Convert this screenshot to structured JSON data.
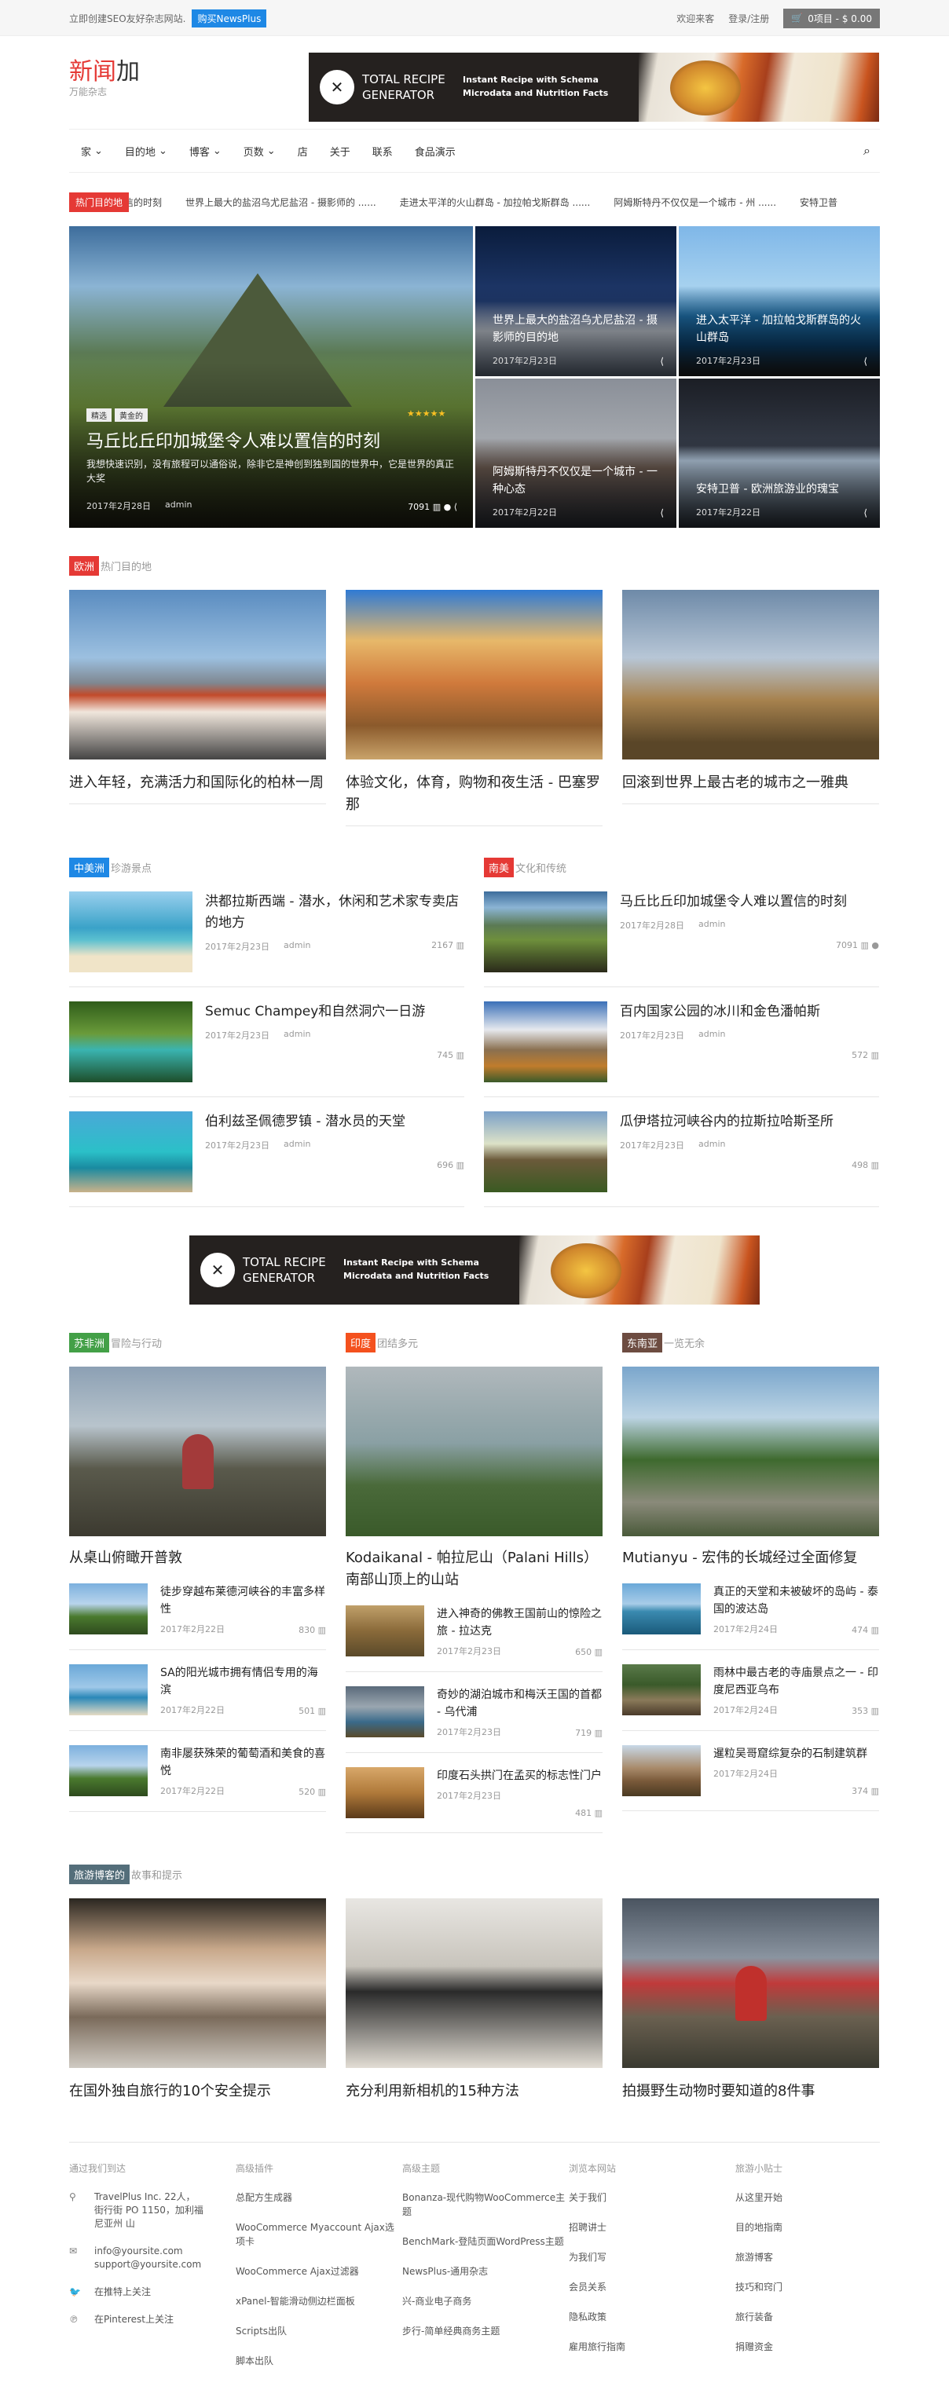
{
  "topbar": {
    "note": "立即创建SEO友好杂志网站.",
    "buy": "购买NewsPlus",
    "links": [
      "欢迎来客",
      "登录/注册"
    ],
    "cart": "0项目 - $ 0.00"
  },
  "header": {
    "logo_a": "新闻",
    "logo_b": "加",
    "tagline": "万能杂志"
  },
  "banner": {
    "title": "TOTAL RECIPE GENERATOR",
    "text": "Instant Recipe with Schema Microdata and Nutrition Facts"
  },
  "nav": {
    "items": [
      "家",
      "目的地",
      "博客",
      "页数",
      "店",
      "关于",
      "联系",
      "食品演示"
    ],
    "dropdowns": [
      true,
      true,
      true,
      true,
      false,
      false,
      false,
      false
    ]
  },
  "ticker": {
    "label": "热门目的地",
    "items": [
      "以置信的时刻",
      "世界上最大的盐沼乌尤尼盐沼 - 摄影师的 ......",
      "走进太平洋的火山群岛 - 加拉帕戈斯群岛 ......",
      "阿姆斯特丹不仅仅是一个城市 - 州 ......",
      "安特卫普"
    ]
  },
  "hero": {
    "main": {
      "tags": [
        "精选",
        "黄金的"
      ],
      "stars": "★★★★★",
      "title": "马丘比丘印加城堡令人难以置信的时刻",
      "excerpt": "我想快速识别，没有旅程可以通俗说，除非它是神创到独到国的世界中，它是世界的真正大奖",
      "date": "2017年2月28日",
      "author": "admin",
      "views": "7091"
    },
    "tiles": [
      {
        "title": "世界上最大的盐沼乌尤尼盐沼 - 摄影师的目的地",
        "date": "2017年2月23日"
      },
      {
        "title": "进入太平洋 - 加拉帕戈斯群岛的火山群岛",
        "date": "2017年2月23日"
      },
      {
        "title": "阿姆斯特丹不仅仅是一个城市 - 一种心态",
        "date": "2017年2月22日"
      },
      {
        "title": "安特卫普 - 欧洲旅游业的瑰宝",
        "date": "2017年2月22日"
      }
    ]
  },
  "europe": {
    "label": "欧洲",
    "sub": "热门目的地",
    "color": "#e53935",
    "cards": [
      "进入年轻，充满活力和国际化的柏林一周",
      "体验文化，体育，购物和夜生活 - 巴塞罗那",
      "回滚到世界上最古老的城市之一雅典"
    ]
  },
  "central": {
    "label": "中美洲",
    "sub": "珍游景点",
    "color": "#1e88e5",
    "rows": [
      {
        "title": "洪都拉斯西端 - 潜水，休闲和艺术家专卖店的地方",
        "date": "2017年2月23日",
        "author": "admin",
        "count": "2167"
      },
      {
        "title": "Semuc Champey和自然洞穴一日游",
        "date": "2017年2月23日",
        "author": "admin",
        "count": "745"
      },
      {
        "title": "伯利兹圣佩德罗镇 - 潜水员的天堂",
        "date": "2017年2月23日",
        "author": "admin",
        "count": "696"
      }
    ]
  },
  "south": {
    "label": "南美",
    "sub": "文化和传统",
    "color": "#e53935",
    "rows": [
      {
        "title": "马丘比丘印加城堡令人难以置信的时刻",
        "date": "2017年2月28日",
        "author": "admin",
        "count": "7091"
      },
      {
        "title": "百内国家公园的冰川和金色潘帕斯",
        "date": "2017年2月23日",
        "author": "admin",
        "count": "572"
      },
      {
        "title": "瓜伊塔拉河峡谷内的拉斯拉哈斯圣所",
        "date": "2017年2月23日",
        "author": "admin",
        "count": "498"
      }
    ]
  },
  "africa": {
    "label": "苏非洲",
    "sub": "冒险与行动",
    "color": "#43a047",
    "main": "从桌山俯瞰开普敦",
    "rows": [
      {
        "title": "徒步穿越布莱德河峡谷的丰富多样性",
        "date": "2017年2月22日",
        "count": "830"
      },
      {
        "title": "SA的阳光城市拥有情侣专用的海滨",
        "date": "2017年2月22日",
        "count": "501"
      },
      {
        "title": "南非屡获殊荣的葡萄酒和美食的喜悦",
        "date": "2017年2月22日",
        "count": "520"
      }
    ]
  },
  "india": {
    "label": "印度",
    "sub": "团结多元",
    "color": "#f4511e",
    "main": "Kodaikanal - 帕拉尼山（Palani Hills）南部山顶上的山站",
    "rows": [
      {
        "title": "进入神奇的佛教王国前山的惊险之旅 - 拉达克",
        "date": "2017年2月23日",
        "count": "650"
      },
      {
        "title": "奇妙的湖泊城市和梅沃王国的首都 - 乌代浦",
        "date": "2017年2月23日",
        "count": "719"
      },
      {
        "title": "印度石头拱门在孟买的标志性门户",
        "date": "2017年2月23日",
        "count": "481"
      }
    ]
  },
  "asia": {
    "label": "东南亚",
    "sub": "一览无余",
    "color": "#6d4c41",
    "main": "Mutianyu - 宏伟的长城经过全面修复",
    "rows": [
      {
        "title": "真正的天堂和未被破坏的岛屿 - 泰国的波达岛",
        "date": "2017年2月24日",
        "count": "474"
      },
      {
        "title": "雨林中最古老的寺庙景点之一 - 印度尼西亚乌布",
        "date": "2017年2月24日",
        "count": "353"
      },
      {
        "title": "暹粒吴哥窟综复杂的石制建筑群",
        "date": "2017年2月24日",
        "count": "374"
      }
    ]
  },
  "blog": {
    "label": "旅游博客的",
    "sub": "故事和提示",
    "color": "#546e7a",
    "cards": [
      "在国外独自旅行的10个安全提示",
      "充分利用新相机的15种方法",
      "拍摄野生动物时要知道的8件事"
    ]
  },
  "footer": {
    "contact": {
      "title": "通过我们到达",
      "address": "TravelPlus Inc. 22人，街行街 PO 1150，加利福尼亚州 山",
      "email": "info@yoursite.com support@yoursite.com",
      "twitter": "在推特上关注",
      "pinterest": "在Pinterest上关注"
    },
    "plugins": {
      "title": "高级插件",
      "items": [
        "总配方生成器",
        "WooCommerce Myaccount Ajax选项卡",
        "WooCommerce Ajax过滤器",
        "xPanel-智能滑动侧边栏面板",
        "Scripts出队",
        "脚本出队"
      ]
    },
    "themes": {
      "title": "高级主题",
      "items": [
        "Bonanza-现代购物WooCommerce主题",
        "BenchMark-登陆页面WordPress主题",
        "NewsPlus-通用杂志",
        "兴-商业电子商务",
        "步行-简单经典商务主题"
      ]
    },
    "browse": {
      "title": "浏览本网站",
      "items": [
        "关于我们",
        "招聘讲士",
        "为我们写",
        "会员关系",
        "隐私政策",
        "雇用旅行指南"
      ]
    },
    "tips": {
      "title": "旅游小贴士",
      "items": [
        "从这里开始",
        "目的地指南",
        "旅游博客",
        "技巧和窍门",
        "旅行装备",
        "捐赠资金"
      ]
    }
  },
  "icons": [
    "cart-icon",
    "search-icon",
    "chevron-down-icon",
    "share-icon",
    "map-pin-icon",
    "envelope-icon",
    "twitter-icon",
    "pinterest-icon",
    "chart-icon",
    "comment-icon"
  ]
}
